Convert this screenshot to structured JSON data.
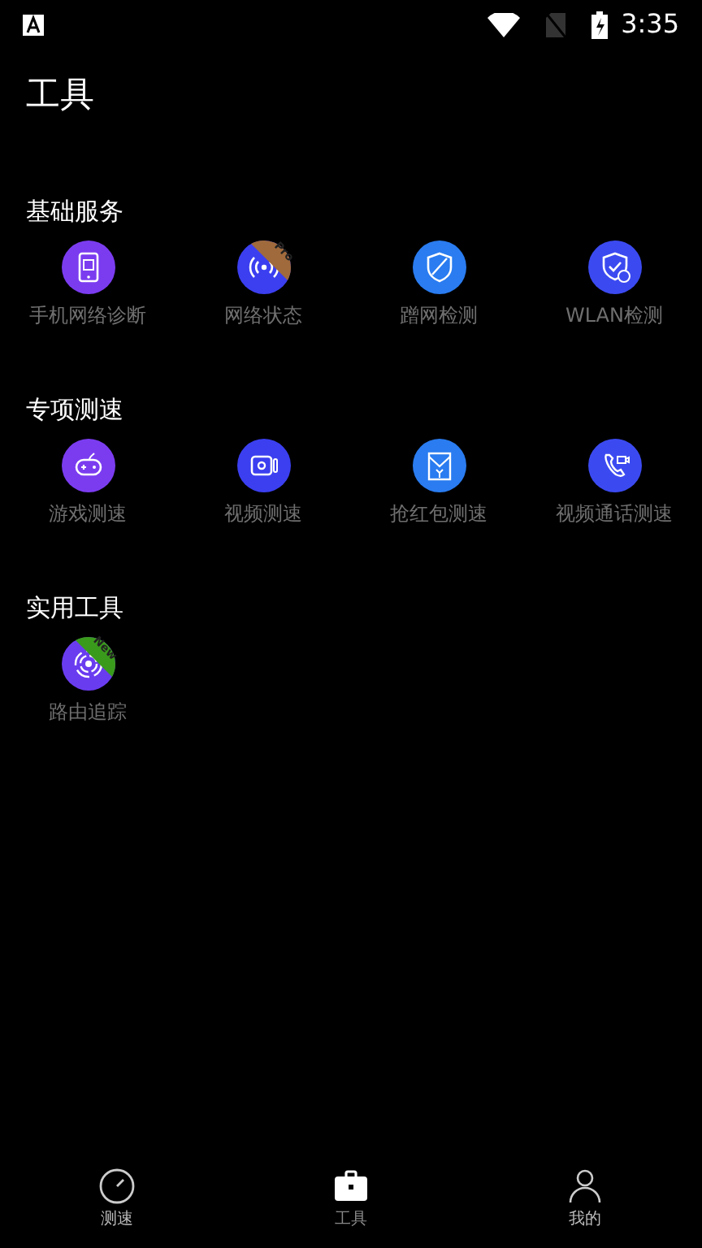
{
  "status_bar": {
    "time": "3:35"
  },
  "header": {
    "title": "工具"
  },
  "sections": [
    {
      "title": "基础服务",
      "items": [
        {
          "label": "手机网络诊断",
          "kind": "phone",
          "color": "#7b3cf0"
        },
        {
          "label": "网络状态",
          "kind": "signal",
          "color": "#3b3ff0",
          "badge": {
            "text": "Pro",
            "color": "#a06a3c"
          }
        },
        {
          "label": "蹭网检测",
          "kind": "shield-off",
          "color": "#2a7cf0"
        },
        {
          "label": "WLAN检测",
          "kind": "shield-check",
          "color": "#3b4af0"
        }
      ]
    },
    {
      "title": "专项测速",
      "items": [
        {
          "label": "游戏测速",
          "kind": "gamepad",
          "color": "#7b3cf0"
        },
        {
          "label": "视频测速",
          "kind": "camera",
          "color": "#3b3ff0"
        },
        {
          "label": "抢红包测速",
          "kind": "envelope",
          "color": "#2a7cf0"
        },
        {
          "label": "视频通话测速",
          "kind": "call",
          "color": "#3b4af0"
        }
      ]
    },
    {
      "title": "实用工具",
      "items": [
        {
          "label": "路由追踪",
          "kind": "radar",
          "color": "#6a3cf0",
          "badge": {
            "text": "New",
            "color": "#3a9a1c"
          }
        }
      ]
    }
  ],
  "bottom_nav": [
    {
      "label": "测速",
      "kind": "gauge",
      "selected": false
    },
    {
      "label": "工具",
      "kind": "briefcase",
      "selected": true
    },
    {
      "label": "我的",
      "kind": "person",
      "selected": false
    }
  ]
}
